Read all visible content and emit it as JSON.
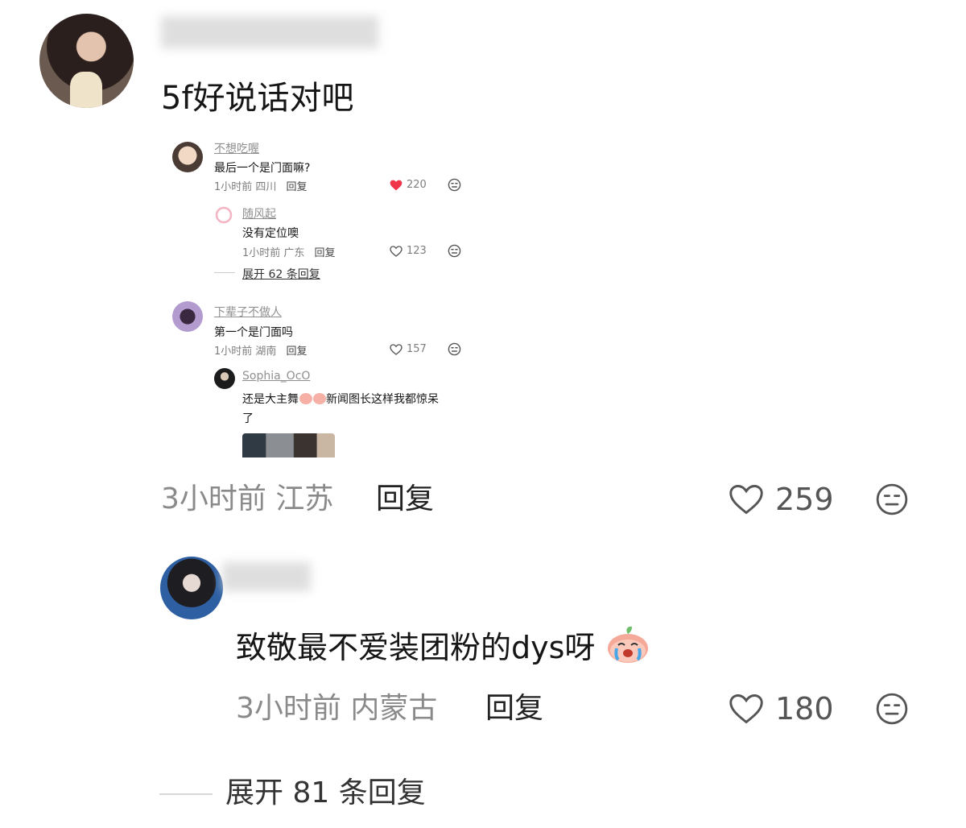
{
  "comment1": {
    "text": "5f好说话对吧",
    "meta": "3小时前 江苏",
    "reply_label": "回复",
    "likes": "259",
    "screenshot": {
      "t1": {
        "name": "不想吃喔",
        "text": "最后一个是门面嘛?",
        "meta": "1小时前 四川",
        "reply_label": "回复",
        "likes": "220"
      },
      "t1_reply": {
        "name": "随风起",
        "text": "没有定位噢",
        "meta": "1小时前 广东",
        "reply_label": "回复",
        "likes": "123"
      },
      "t1_expand": "展开 62 条回复",
      "t2": {
        "name": "下辈子不做人",
        "text": "第一个是门面吗",
        "meta": "1小时前 湖南",
        "reply_label": "回复",
        "likes": "157"
      },
      "t2_reply": {
        "name": "Sophia_OcO",
        "text_a": "还是大主舞",
        "text_b": "新闻图长这样我都惊呆",
        "text_c": "了"
      }
    }
  },
  "comment2": {
    "text": "致敬最不爱装团粉的dys呀",
    "meta": "3小时前 内蒙古",
    "reply_label": "回复",
    "likes": "180"
  },
  "expand_replies": "展开 81 条回复",
  "colors": {
    "like_red": "#f0344a",
    "muted": "#8a8a8a",
    "text": "#161616"
  },
  "icons": [
    "heart-outline-icon",
    "heart-filled-icon",
    "meh-face-icon",
    "crying-peach-emoji"
  ]
}
